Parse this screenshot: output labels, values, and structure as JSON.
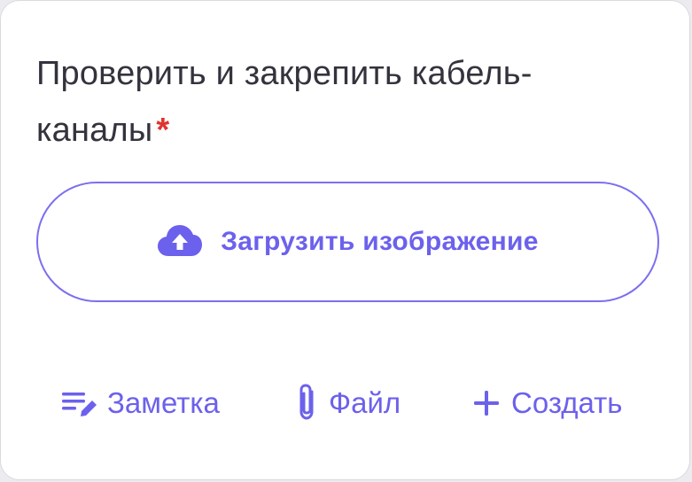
{
  "task": {
    "title": "Проверить и закрепить кабель-каналы",
    "required_marker": "*"
  },
  "upload": {
    "label": "Загрузить изображение",
    "icon": "cloud-upload-icon"
  },
  "actions": [
    {
      "label": "Заметка",
      "icon": "note-edit-icon"
    },
    {
      "label": "Файл",
      "icon": "paperclip-icon"
    },
    {
      "label": "Создать",
      "icon": "plus-icon"
    }
  ],
  "colors": {
    "accent": "#6c61ec",
    "border_accent": "#7b6ff0",
    "required": "#e0342f",
    "text": "#34333d"
  }
}
